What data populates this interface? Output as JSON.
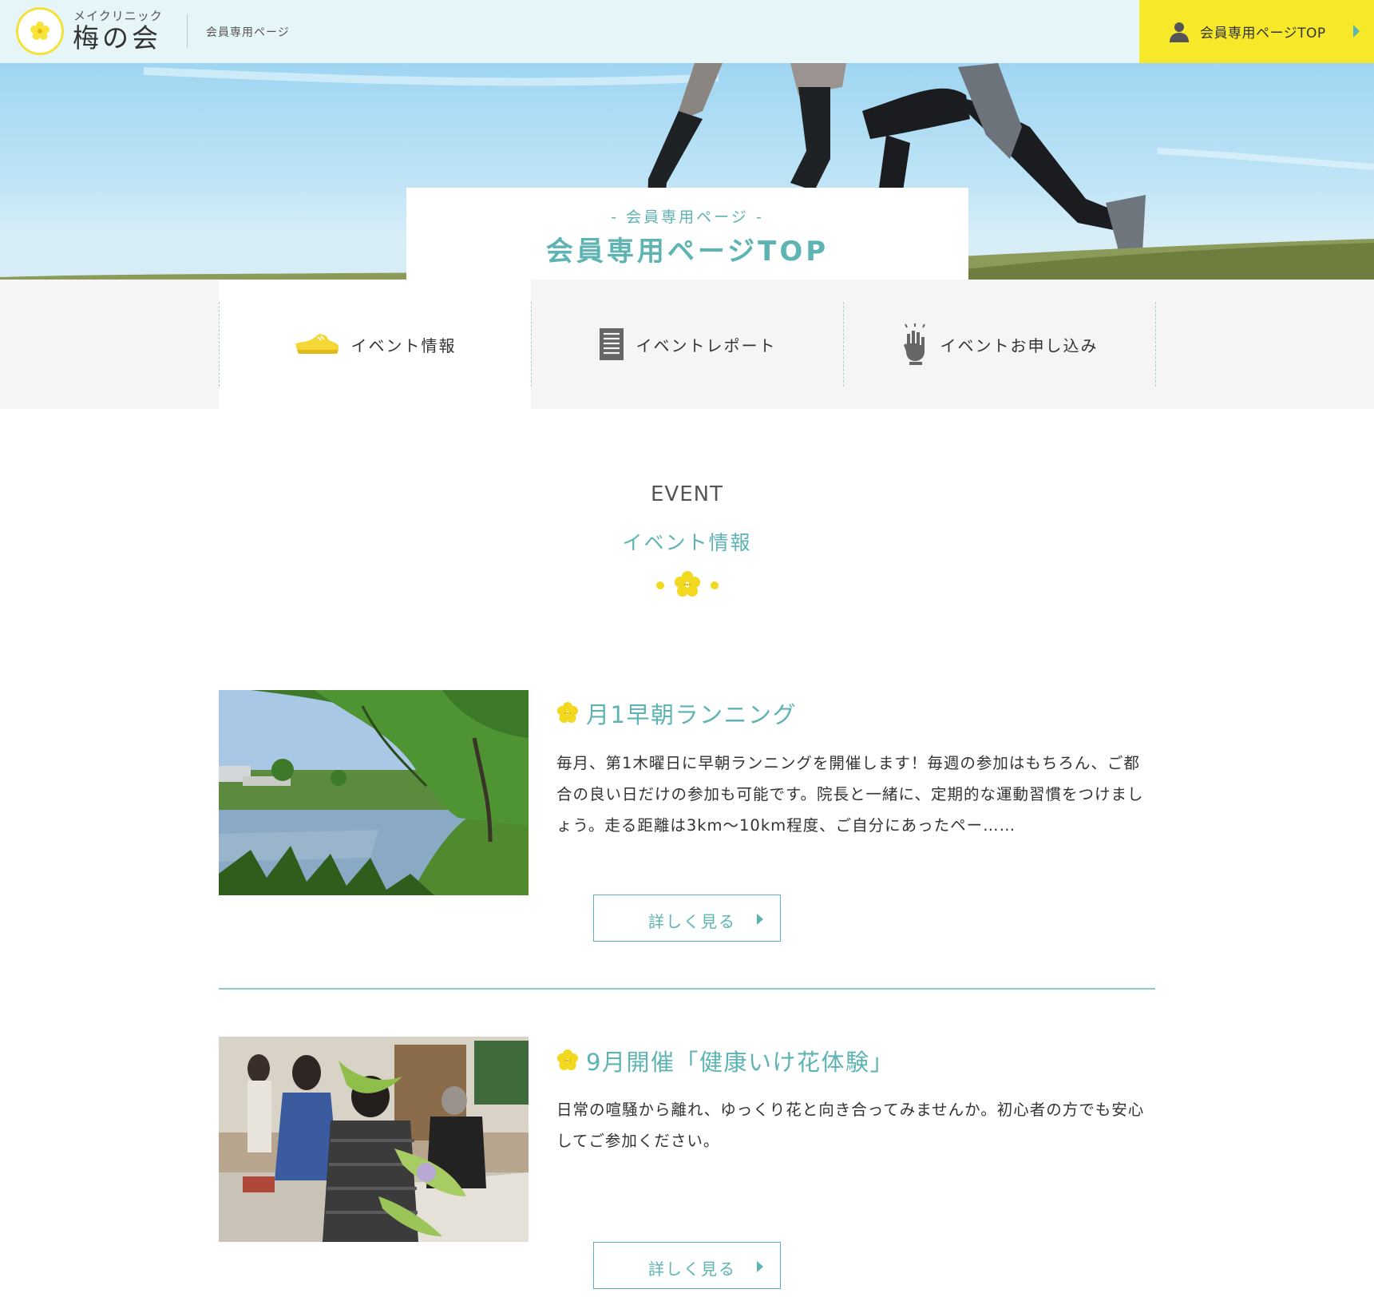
{
  "header": {
    "logo_sub": "メイクリニック",
    "logo_main": "梅の会",
    "page_label": "会員専用ページ",
    "member_top_button": "会員専用ページTOP"
  },
  "hero": {
    "subtitle": "- 会員専用ページ -",
    "title": "会員専用ページTOP"
  },
  "tabs": [
    {
      "label": "イベント情報",
      "icon": "running-shoe-icon",
      "active": true
    },
    {
      "label": "イベントレポート",
      "icon": "document-icon",
      "active": false
    },
    {
      "label": "イベントお申し込み",
      "icon": "raised-hand-icon",
      "active": false
    }
  ],
  "section": {
    "en": "EVENT",
    "ja": "イベント情報"
  },
  "events": [
    {
      "title": "月1早朝ランニング",
      "description": "毎月、第1木曜日に早朝ランニングを開催します！毎週の参加はもちろん、ご都合の良い日だけの参加も可能です。院長と一緒に、定期的な運動習慣をつけましょう。走る距離は3km〜10km程度、ご自分にあったペー……",
      "button": "詳しく見る"
    },
    {
      "title": "9月開催「健康いけ花体験」",
      "description": "日常の喧騒から離れ、ゆっくり花と向き合ってみませんか。初心者の方でも安心してご参加ください。",
      "button": "詳しく見る"
    }
  ],
  "colors": {
    "accent_teal": "#5eb3b3",
    "accent_yellow": "#f7e92a",
    "header_bg": "#e6f5f8",
    "nav_bg": "#f5f5f5"
  }
}
